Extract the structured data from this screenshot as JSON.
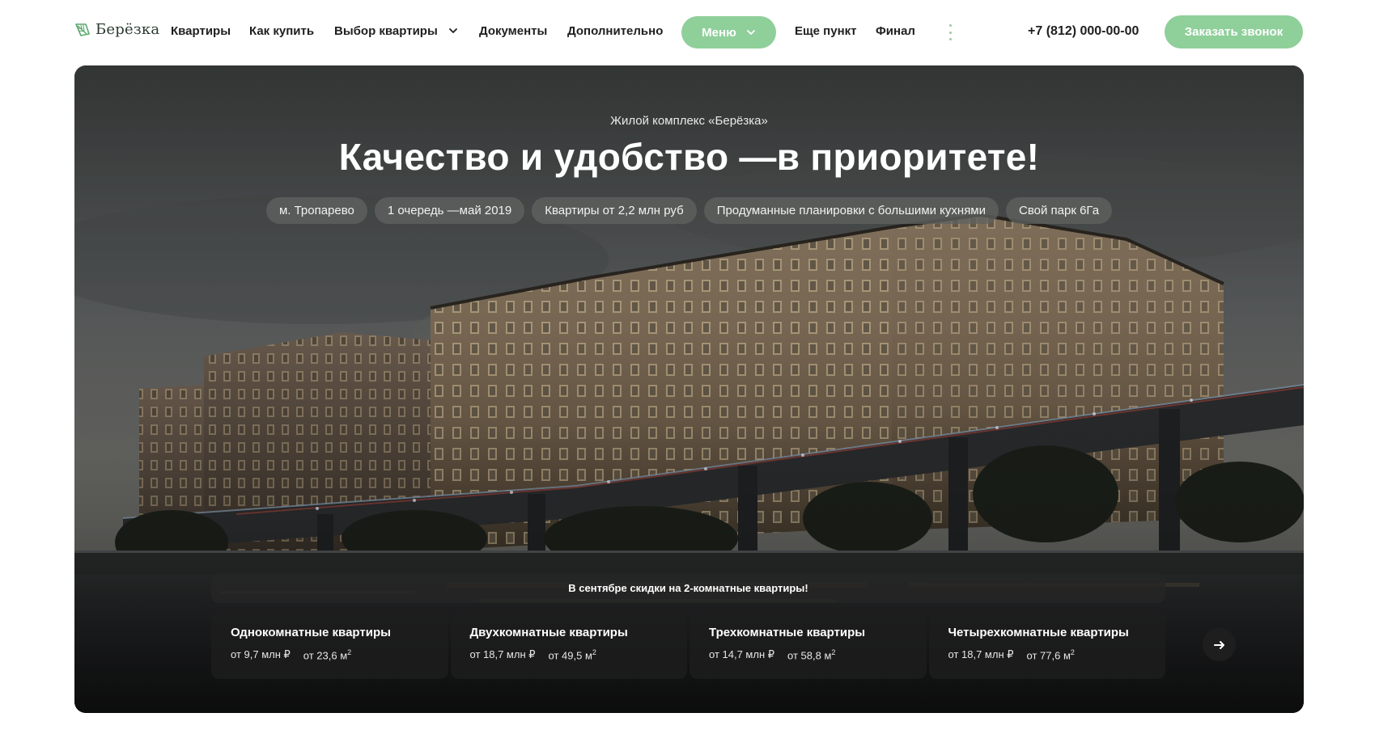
{
  "brand": {
    "name": "Берёзка",
    "color": "#4f9c64",
    "accent": "#8fcf9a"
  },
  "nav": {
    "items": [
      "Квартиры",
      "Как купить",
      "Выбор квартиры",
      "Документы",
      "Дополнительно"
    ],
    "menu_label": "Меню",
    "extra_items": [
      "Еще пункт",
      "Финал"
    ],
    "more_icon": "kebab-vertical-icon"
  },
  "contact": {
    "phone": "+7 (812) 000-00-00",
    "callback_label": "Заказать звонок"
  },
  "hero": {
    "eyebrow": "Жилой комплекс «Берёзка»",
    "title": "Качество и удобство —в приоритете!",
    "chips": [
      "м. Тропарево",
      "1 очередь —май 2019",
      "Квартиры от 2,2 млн руб",
      "Продуманные планировки с большими кухнями",
      "Свой парк 6Га"
    ],
    "promo": "В сентябре скидки на 2-комнатные квартиры!",
    "cards": [
      {
        "title": "Однокомнатные квартиры",
        "price": "от 9,7 млн ₽",
        "area": "от 23,6 м",
        "area_unit_sup": "2"
      },
      {
        "title": "Двухкомнатные квартиры",
        "price": "от 18,7 млн ₽",
        "area": "от 49,5 м",
        "area_unit_sup": "2"
      },
      {
        "title": "Трехкомнатные квартиры",
        "price": "от 14,7 млн ₽",
        "area": "от 58,8 м",
        "area_unit_sup": "2"
      },
      {
        "title": "Четырехкомнатные квартиры",
        "price": "от 18,7 млн ₽",
        "area": "от 77,6 м",
        "area_unit_sup": "2"
      }
    ],
    "next_icon": "arrow-right-icon"
  }
}
